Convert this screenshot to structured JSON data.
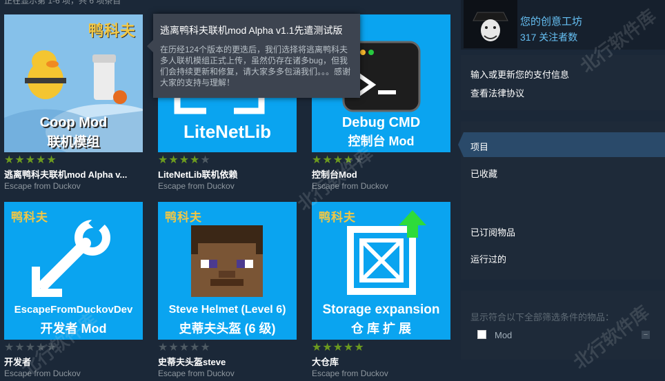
{
  "header": {
    "status_text": "正在显示第 1-6 项，共 6 项条目"
  },
  "items": [
    {
      "brand": "鸭科夫",
      "line1": "Coop Mod",
      "line2": "联机模组",
      "title": "逃离鸭科夫联机mod Alpha v...",
      "game": "Escape from Duckov",
      "rating": 5
    },
    {
      "brand": "",
      "line1": "LiteNetLib",
      "line2": "",
      "title": "LiteNetLib联机依赖",
      "game": "Escape from Duckov",
      "rating": 4
    },
    {
      "brand": "",
      "line1": "Debug CMD",
      "line2": "控制台 Mod",
      "title": "控制台Mod",
      "game": "Escape from Duckov",
      "rating": 4
    },
    {
      "brand": "鸭科夫",
      "line1": "EscapeFromDuckovDev",
      "line2": "开发者 Mod",
      "title": "开发者",
      "game": "Escape from Duckov",
      "rating": 0
    },
    {
      "brand": "鸭科夫",
      "line1": "Steve Helmet (Level 6)",
      "line2": "史蒂夫头盔 (6 级)",
      "title": "史蒂夫头盔steve",
      "game": "Escape from Duckov",
      "rating": 0
    },
    {
      "brand": "鸭科夫",
      "line1": "Storage expansion",
      "line2": "仓 库 扩 展",
      "title": "大仓库",
      "game": "Escape from Duckov",
      "rating": 5
    }
  ],
  "tooltip": {
    "title": "逃离鸭科夫联机mod Alpha v1.1先遣测试版",
    "description": "在历经124个版本的更迭后，我们选择将逃离鸭科夫多人联机模组正式上传，虽然仍存在诸多bug，但我们会持续更新和修复，请大家多多包涵我们。。。感谢大家的支持与理解！"
  },
  "profile": {
    "name": "您的创意工坊",
    "followers": "317 关注者数"
  },
  "links": {
    "payment": "输入或更新您的支付信息",
    "legal": "查看法律协议"
  },
  "nav": {
    "items": "项目",
    "favorites": "已收藏",
    "subscribed": "已订阅物品",
    "played": "运行过的"
  },
  "filter": {
    "label": "显示符合以下全部筛选条件的物品：",
    "option": "Mod"
  },
  "watermark": "北行软件库",
  "colors": {
    "thumb_bg": "#0aa4f0",
    "accent_link": "#66c0f4",
    "star_on": "#6c9a1f",
    "brand_yellow": "#f2c744"
  }
}
